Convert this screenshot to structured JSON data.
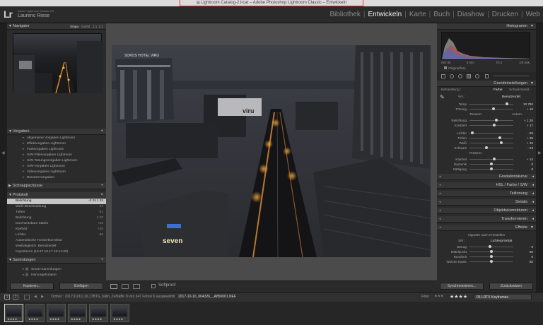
{
  "window": {
    "title": "Lightroom Catalog-2.lrcat – Adobe Photoshop Lightroom Classic – Entwickeln"
  },
  "header": {
    "logo": "Lr",
    "app_name": "Adobe Lightroom Classic CC",
    "user": "Laurenc Riese",
    "modules": [
      {
        "label": "Bibliothek",
        "active": false
      },
      {
        "label": "Entwickeln",
        "active": true
      },
      {
        "label": "Karte",
        "active": false
      },
      {
        "label": "Buch",
        "active": false
      },
      {
        "label": "Diashow",
        "active": false
      },
      {
        "label": "Drucken",
        "active": false
      },
      {
        "label": "Web",
        "active": false
      }
    ]
  },
  "left": {
    "navigator": {
      "title": "Navigator",
      "zoom": [
        "Einpa.",
        "Ausfül.",
        "1:1",
        "3:1"
      ]
    },
    "presets": {
      "title": "Vorgaben",
      "items": [
        "Allgemeine Vorgaben Lightroom",
        "Effektvorgaben Lightroom",
        "Farbvorgaben Lightroom",
        "S/W-Filtervorgaben Lightroom",
        "S/W-Tonungsvorgaben Lightroom",
        "S/W-Vorgaben Lightroom",
        "Videovorgaben Lightroom",
        "Benutzervorgaben"
      ]
    },
    "snapshots": {
      "title": "Schnappschüsse"
    },
    "history": {
      "title": "Protokoll",
      "rows": [
        {
          "label": "Belichtung",
          "v1": "-0.35",
          "v2": "1.35",
          "selected": true
        },
        {
          "label": "Weiß-Beschneidung",
          "v1": "",
          "v2": "34"
        },
        {
          "label": "Tiefen",
          "v1": "",
          "v2": "81"
        },
        {
          "label": "Belichtung",
          "v1": "",
          "v2": "1,70"
        },
        {
          "label": "Durchsetzbare Stärke",
          "v1": "",
          "v2": "+10"
        },
        {
          "label": "Klarheit",
          "v1": "",
          "v2": "+10"
        },
        {
          "label": "Lichter",
          "v1": "",
          "v2": "-86"
        },
        {
          "label": "Automatische Tonwertkorrektur",
          "v1": "",
          "v2": ""
        },
        {
          "label": "Weißabgleich: Benutzerdef.",
          "v1": "",
          "v2": ""
        },
        {
          "label": "Importieren (10.27.10.17 15:14:20)",
          "v1": "",
          "v2": ""
        }
      ]
    },
    "collections": {
      "title": "Sammlungen",
      "items": [
        "Smart-Sammlungen",
        "Hervorgehobene"
      ]
    },
    "buttons": {
      "copy": "Kopieren...",
      "paste": "Einfügen"
    }
  },
  "right": {
    "histogram": {
      "title": "Histogramm",
      "info": [
        "ISO 80",
        "5 mm",
        "f/2,2",
        "1/6 Sek."
      ],
      "original_photo": "Originalfoto"
    },
    "basic": {
      "title": "Grundeinstellungen",
      "treatment_label": "Behandlung :",
      "treatment_color": "Farbe",
      "treatment_bw": "Schwarzweiß",
      "wb_label": "WA :",
      "wb_value": "Benutzerdef.",
      "wb_sliders": [
        {
          "label": "Temp",
          "value": "10 750",
          "pos": 0.85
        },
        {
          "label": "Tönung",
          "value": "+ 10",
          "pos": 0.55
        }
      ],
      "tone_label": "Tonwert",
      "tone_auto": "Autom.",
      "tone_sliders": [
        {
          "label": "Belichtung",
          "value": "+ 1,35",
          "pos": 0.62
        },
        {
          "label": "Kontrast",
          "value": "+ 17",
          "pos": 0.56
        }
      ],
      "tone_sliders2": [
        {
          "label": "Lichter",
          "value": "- 85",
          "pos": 0.07
        },
        {
          "label": "Tiefen",
          "value": "+ 39",
          "pos": 0.7
        },
        {
          "label": "Weiß",
          "value": "+ 46",
          "pos": 0.73
        },
        {
          "label": "Schwarz",
          "value": "- 23",
          "pos": 0.38
        }
      ],
      "presence_label": "Präsenz",
      "presence_sliders": [
        {
          "label": "Klarheit",
          "value": "+ 14",
          "pos": 0.57
        },
        {
          "label": "Dynamik",
          "value": "0",
          "pos": 0.5
        },
        {
          "label": "Sättigung",
          "value": "0",
          "pos": 0.5
        }
      ]
    },
    "sections": [
      "Gradationskurve",
      "HSL / Farbe / S/W",
      "Teiltonung",
      "Details",
      "Objektivkorrekturen",
      "Transformieren",
      "Effekte"
    ],
    "effects": {
      "vignette_label": "Vignette nach Freistellen",
      "style_label": "Stil :",
      "style_value": "Lichterpriorität",
      "sliders": [
        {
          "label": "Betrag",
          "value": "- 9",
          "pos": 0.46
        },
        {
          "label": "Mittelpunkt",
          "value": "50",
          "pos": 0.5
        },
        {
          "label": "Rundheit",
          "value": "0",
          "pos": 0.5
        },
        {
          "label": "Weiche Kante",
          "value": "50",
          "pos": 0.5
        }
      ]
    },
    "buttons": {
      "sync": "Synchronisieren...",
      "reset": "Zurücksetzen"
    }
  },
  "photo": {
    "sign_viru": "viru",
    "sign_seven": "seven",
    "sign_hotel": "SOKOS HOTEL VIRU"
  },
  "toolbar": {
    "softproof": "Softproof"
  },
  "filmstrip": {
    "pages": [
      "1",
      "2"
    ],
    "path": "Ordner : 2017/10/10_06_DBTG_fallin_Zehtaffe",
    "info": "8 von 347 Fotos/ 6 ausgewählt/",
    "file": "2017-10-10_064326__A850001.NEF",
    "filter_label": "Filter :",
    "stars": "★★★★",
    "preset": "05 LRTX Keyframes"
  },
  "colors": {
    "accent": "#e0342a",
    "panel": "#2b2b2b",
    "selected": "#c6c6c6"
  }
}
